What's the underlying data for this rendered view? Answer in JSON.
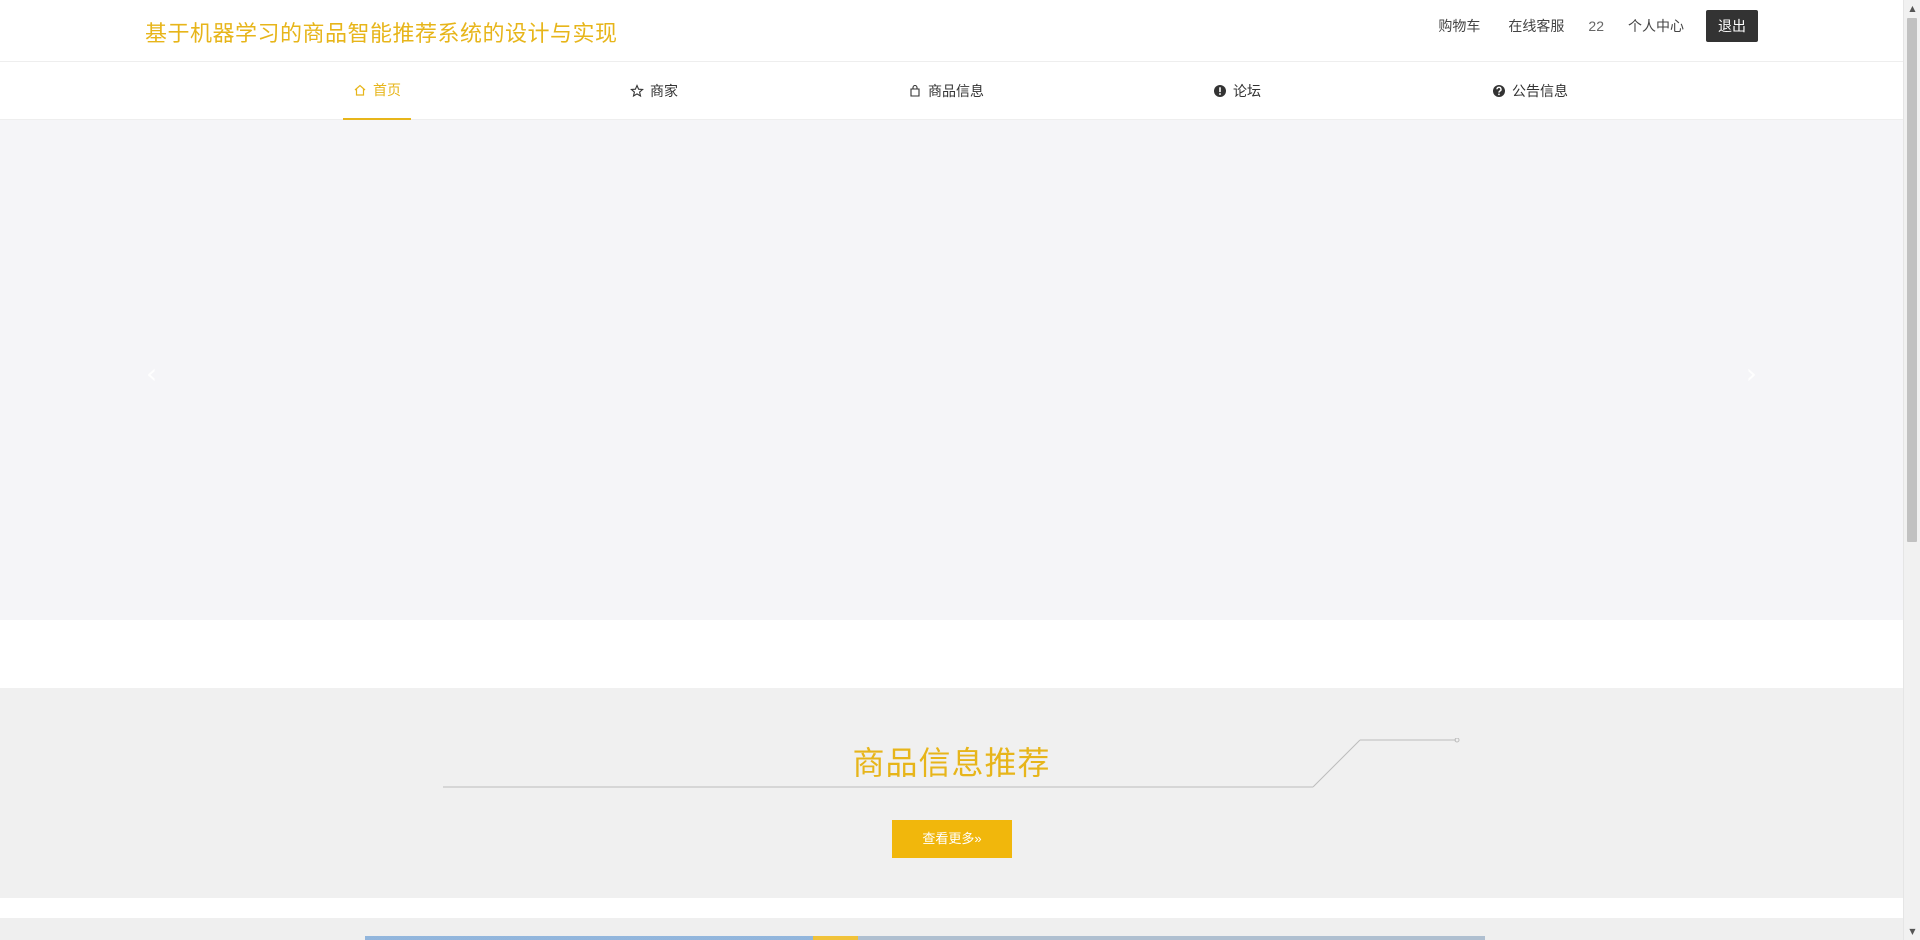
{
  "header": {
    "site_title": "基于机器学习的商品智能推荐系统的设计与实现",
    "links": {
      "cart": "购物车",
      "service": "在线客服",
      "username": "22",
      "profile": "个人中心",
      "logout": "退出"
    }
  },
  "nav": {
    "items": [
      {
        "label": "首页",
        "icon": "home-icon",
        "active": true
      },
      {
        "label": "商家",
        "icon": "star-icon",
        "active": false
      },
      {
        "label": "商品信息",
        "icon": "bag-icon",
        "active": false
      },
      {
        "label": "论坛",
        "icon": "exclamation-circle-icon",
        "active": false
      },
      {
        "label": "公告信息",
        "icon": "question-circle-icon",
        "active": false
      }
    ]
  },
  "carousel": {
    "prev": "‹",
    "next": "›"
  },
  "section": {
    "title": "商品信息推荐",
    "more_label": "查看更多»"
  },
  "colors": {
    "accent": "#e7b51a",
    "button": "#f1b70c",
    "dark_button": "#333333",
    "banner_bg": "#f5f5f8",
    "section_bg": "#f0f0f0"
  }
}
